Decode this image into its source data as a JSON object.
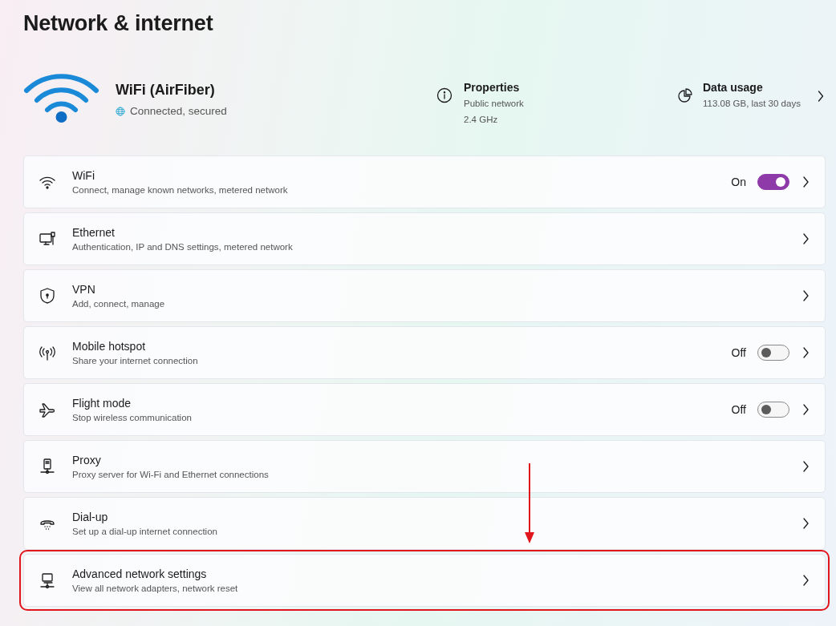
{
  "page_title": "Network & internet",
  "connection": {
    "name": "WiFi (AirFiber)",
    "status": "Connected, secured"
  },
  "properties": {
    "title": "Properties",
    "lines": [
      "Public network",
      "2.4 GHz"
    ]
  },
  "data_usage": {
    "title": "Data usage",
    "detail": "113.08 GB, last 30 days"
  },
  "rows": [
    {
      "title": "WiFi",
      "subtitle": "Connect, manage known networks, metered network",
      "kind": "toggle",
      "toggle_label": "On",
      "on": true,
      "highlighted": false
    },
    {
      "title": "Ethernet",
      "subtitle": "Authentication, IP and DNS settings, metered network",
      "kind": "link",
      "highlighted": false
    },
    {
      "title": "VPN",
      "subtitle": "Add, connect, manage",
      "kind": "link",
      "highlighted": false
    },
    {
      "title": "Mobile hotspot",
      "subtitle": "Share your internet connection",
      "kind": "toggle",
      "toggle_label": "Off",
      "on": false,
      "highlighted": false
    },
    {
      "title": "Flight mode",
      "subtitle": "Stop wireless communication",
      "kind": "toggle",
      "toggle_label": "Off",
      "on": false,
      "highlighted": false
    },
    {
      "title": "Proxy",
      "subtitle": "Proxy server for Wi-Fi and Ethernet connections",
      "kind": "link",
      "highlighted": false
    },
    {
      "title": "Dial-up",
      "subtitle": "Set up a dial-up internet connection",
      "kind": "link",
      "highlighted": false
    },
    {
      "title": "Advanced network settings",
      "subtitle": "View all network adapters, network reset",
      "kind": "link",
      "highlighted": true
    }
  ]
}
